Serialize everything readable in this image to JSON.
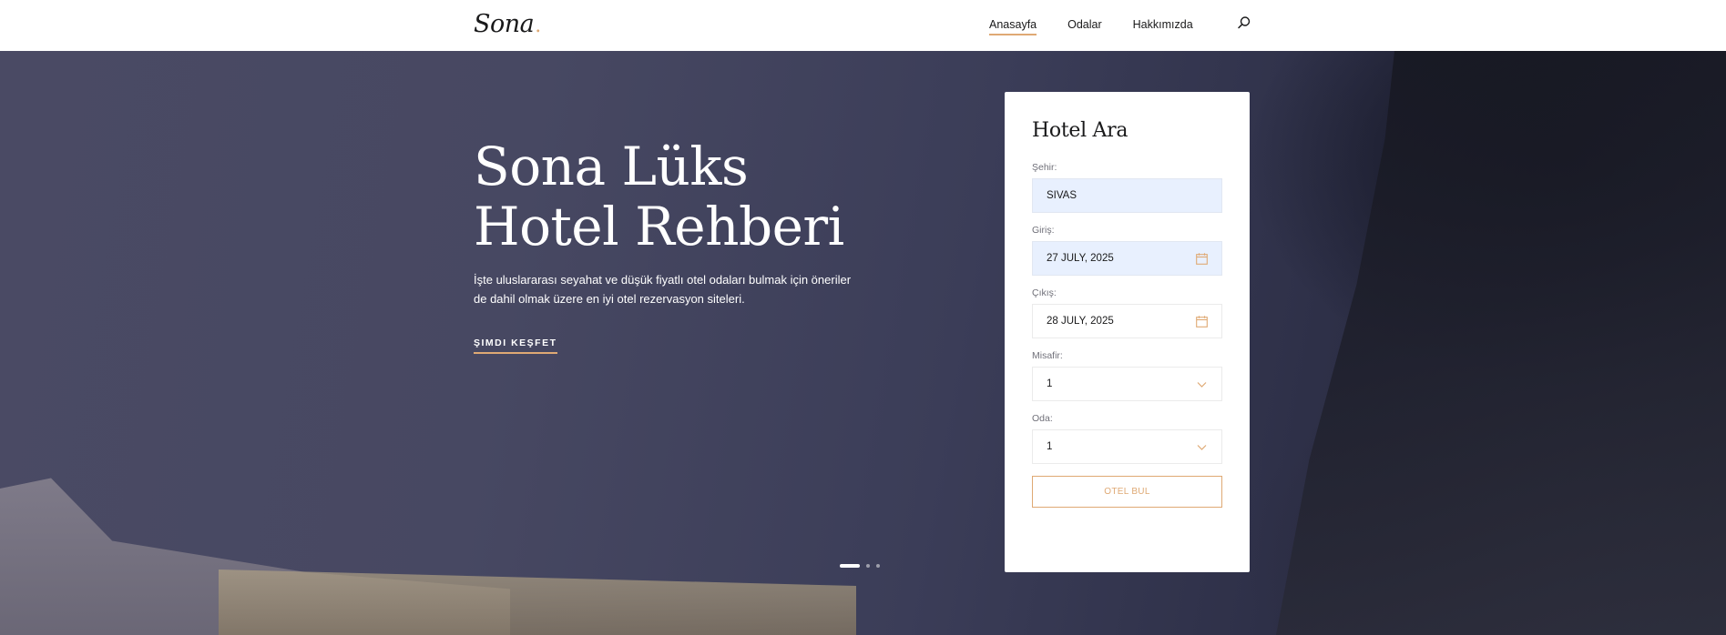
{
  "header": {
    "logo_text": "Sona",
    "logo_dot": ".",
    "nav": [
      {
        "label": "Anasayfa",
        "active": true
      },
      {
        "label": "Odalar",
        "active": false
      },
      {
        "label": "Hakkımızda",
        "active": false
      }
    ],
    "search_icon": "search-icon"
  },
  "hero": {
    "title_line1": "Sona Lüks",
    "title_line2": "Hotel Rehberi",
    "text": "İşte uluslararası seyahat ve düşük fiyatlı otel odaları bulmak için öneriler de dahil olmak üzere en iyi otel rezervasyon siteleri.",
    "cta": "ŞIMDI KEŞFET",
    "slides": 3,
    "active_slide": 0
  },
  "booking": {
    "title": "Hotel Ara",
    "city_label": "Şehir:",
    "city_value": "SIVAS",
    "checkin_label": "Giriş:",
    "checkin_value": "27 JULY, 2025",
    "checkout_label": "Çıkış:",
    "checkout_value": "28 JULY, 2025",
    "guest_label": "Misafir:",
    "guest_value": "1",
    "room_label": "Oda:",
    "room_value": "1",
    "submit": "OTEL BUL"
  },
  "colors": {
    "accent": "#dfa974",
    "text_dark": "#19191a",
    "autofill": "#e8f0fe"
  }
}
